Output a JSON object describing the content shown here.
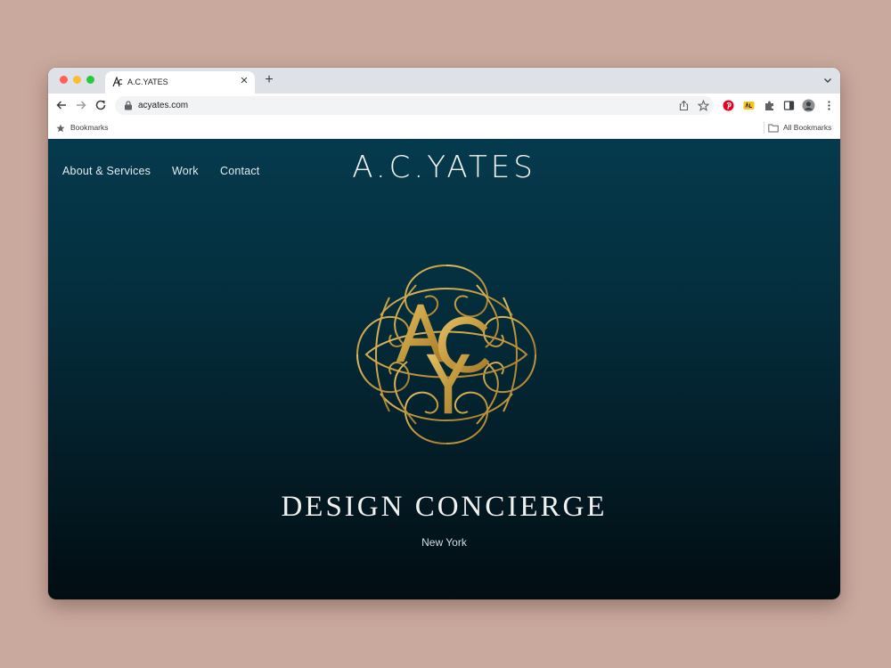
{
  "browser": {
    "tab_title": "A.C.YATES",
    "url": "acyates.com",
    "bookmarks_label": "Bookmarks",
    "all_bookmarks_label": "All Bookmarks"
  },
  "site": {
    "nav": [
      "About & Services",
      "Work",
      "Contact"
    ],
    "title": "A.C.YATES",
    "monogram_letters": "ACY",
    "headline": "DESIGN CONCIERGE",
    "location": "New York"
  },
  "colors": {
    "page_background": "#c9a99d",
    "site_background_top": "#053a4d",
    "site_background_bottom": "#020d12",
    "monogram_gold": "#c9a24b"
  },
  "icons": [
    "back-arrow-icon",
    "forward-arrow-icon",
    "reload-icon",
    "lock-icon",
    "share-icon",
    "bookmark-star-icon",
    "pinterest-icon",
    "extension-icon",
    "puzzle-icon",
    "sidepanel-icon",
    "profile-avatar",
    "more-menu-icon",
    "folder-icon"
  ]
}
